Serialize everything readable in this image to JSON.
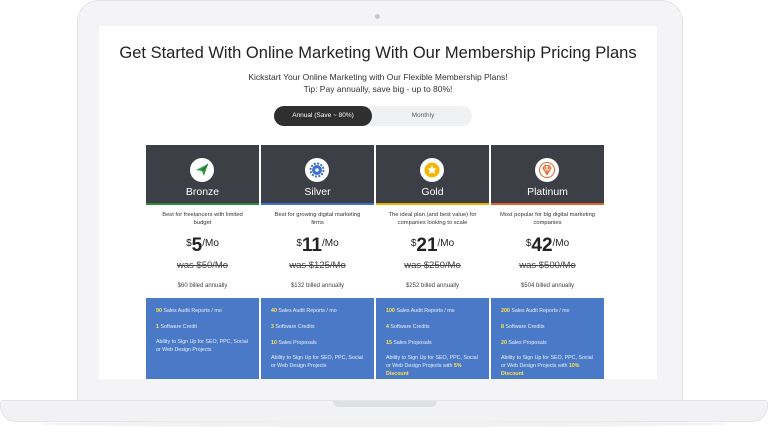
{
  "page": {
    "title": "Get Started With Online Marketing With Our Membership Pricing Plans",
    "subtitle_line1": "Kickstart Your Online Marketing with Our Flexible Membership Plans!",
    "subtitle_line2": "Tip: Pay annually, save big - up to 80%!"
  },
  "toggle": {
    "annual_label": "Annual (Save ~ 80%)",
    "monthly_label": "Monthly",
    "selected": "annual"
  },
  "plans": [
    {
      "name": "Bronze",
      "icon": "paper-plane-icon",
      "accent": "#2e8b3e",
      "description": "Best for freelancers with limited budget",
      "currency": "$",
      "price": "5",
      "per": "/Mo",
      "was": "was $50/Mo",
      "billed": "$60 billed annually",
      "f1_num": "90",
      "f1_text": " Sales Audit Reports / mo",
      "f2_num": "1",
      "f2_text": " Software Credit",
      "f3_text": "Ability to Sign Up for SEO, PPC, Social or Web Design Projects",
      "f4_text": ""
    },
    {
      "name": "Silver",
      "icon": "gear-icon",
      "accent": "#3f6fd0",
      "description": "Best for growing digital marketing firms",
      "currency": "$",
      "price": "11",
      "per": "/Mo",
      "was": "was $125/Mo",
      "billed": "$132 billed annually",
      "f1_num": "40",
      "f1_text": " Sales Audit Reports / mo",
      "f2_num": "3",
      "f2_text": " Software Credits",
      "f3_num": "10",
      "f3_text": " Sales Proposals",
      "f4_text": "Ability to Sign Up for SEO, PPC, Social or Web Design Projects"
    },
    {
      "name": "Gold",
      "icon": "star-icon",
      "accent": "#e9b400",
      "description": "The ideal plan (and best value) for companies looking to scale",
      "currency": "$",
      "price": "21",
      "per": "/Mo",
      "was": "was $250/Mo",
      "billed": "$252 billed annually",
      "f1_num": "100",
      "f1_text": " Sales Audit Reports / mo",
      "f2_num": "4",
      "f2_text": " Software Credits",
      "f3_num": "15",
      "f3_text": " Sales Proposals",
      "f4_text": "Ability to Sign Up for SEO, PPC, Social or Web Design Projects with ",
      "f4_hl": "5% Discount"
    },
    {
      "name": "Platinum",
      "icon": "diamond-icon",
      "accent": "#e2632a",
      "description": "Most popular for big digital marketing companies",
      "currency": "$",
      "price": "42",
      "per": "/Mo",
      "was": "was $500/Mo",
      "billed": "$504 billed annually",
      "f1_num": "200",
      "f1_text": " Sales Audit Reports / mo",
      "f2_num": "8",
      "f2_text": " Software Credits",
      "f3_num": "20",
      "f3_text": " Sales Proposals",
      "f4_text": "Ability to Sign Up for SEO, PPC, Social or Web Design Projects with ",
      "f4_hl": "10% Discount"
    }
  ]
}
